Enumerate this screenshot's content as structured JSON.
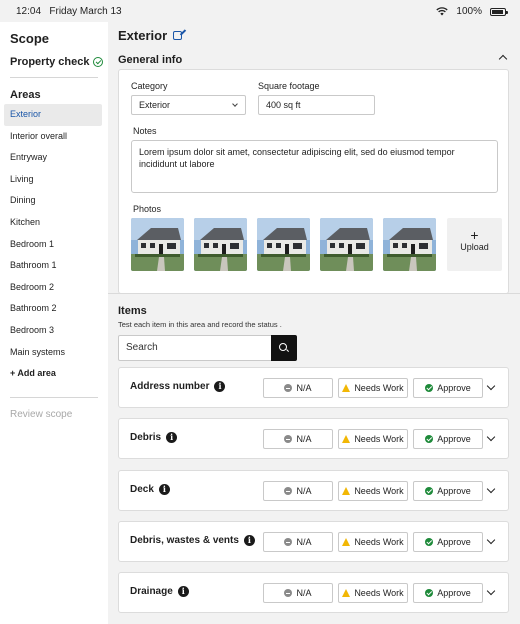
{
  "status_bar": {
    "time": "12:04",
    "date": "Friday March 13",
    "battery": "100%"
  },
  "sidebar": {
    "title": "Scope",
    "property_check": "Property check",
    "areas_heading": "Areas",
    "items": [
      "Exterior",
      "Interior overall",
      "Entryway",
      "Living",
      "Dining",
      "Kitchen",
      "Bedroom 1",
      "Bathroom 1",
      "Bedroom 2",
      "Bathroom 2",
      "Bedroom 3",
      "Main systems"
    ],
    "active_item": "Exterior",
    "add_area": "+ Add area",
    "review_scope": "Review scope"
  },
  "main": {
    "title": "Exterior",
    "general_info": {
      "heading": "General info",
      "category_label": "Category",
      "category_value": "Exterior",
      "sqft_label": "Square footage",
      "sqft_value": "400 sq ft",
      "notes_label": "Notes",
      "notes_value": "Lorem ipsum dolor sit amet, consectetur adipiscing elit, sed do eiusmod tempor incididunt ut labore",
      "photos_label": "Photos",
      "photo_count": 5,
      "upload_plus": "+",
      "upload_label": "Upload"
    },
    "items_section": {
      "heading": "Items",
      "subtitle": "Test each item in this area and record the status .",
      "search_placeholder": "Search",
      "options": {
        "na": "N/A",
        "needs_work": "Needs Work",
        "approve": "Approve"
      },
      "rows": [
        {
          "name": "Address number"
        },
        {
          "name": "Debris"
        },
        {
          "name": "Deck"
        },
        {
          "name": "Debris, wastes & vents"
        },
        {
          "name": "Drainage"
        }
      ]
    }
  },
  "colors": {
    "accent": "#1a56a8",
    "approve": "#1e8a3a",
    "warning": "#f2b705",
    "na": "#8a8a8a"
  }
}
